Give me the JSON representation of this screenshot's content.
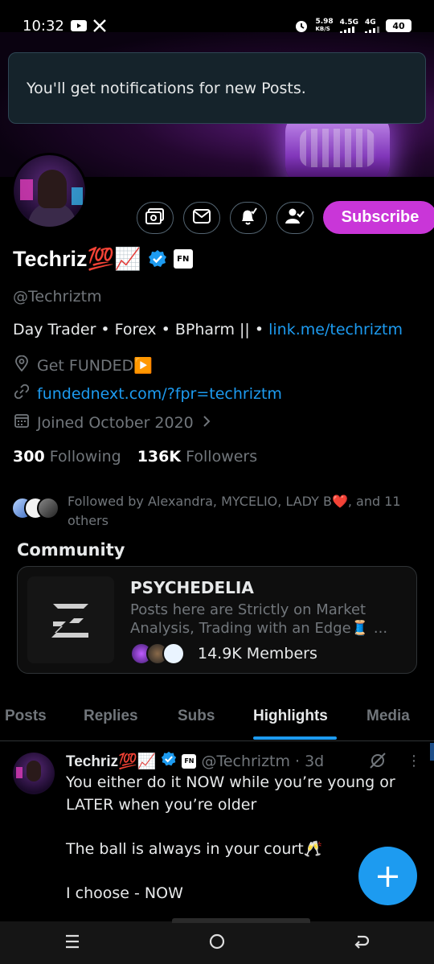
{
  "status_bar": {
    "time": "10:32",
    "speed_value": "5.98",
    "speed_unit": "KB/S",
    "network_1": "4.5G",
    "network_2": "4G",
    "battery": "40"
  },
  "toast": {
    "message": "You'll get notifications for new Posts."
  },
  "profile_actions": {
    "subscribe_label": "Subscribe"
  },
  "profile": {
    "display_name": "Techriz💯📈",
    "fn_badge": "FN",
    "handle": "@Techriztm",
    "bio_text": "Day Trader • Forex • BPharm || • ",
    "bio_link": "link.me/techriztm",
    "location": "Get FUNDED▶️",
    "website": "fundednext.com/?fpr=techriztm",
    "joined": "Joined October 2020",
    "following_count": "300",
    "following_label": "Following",
    "followers_count": "136K",
    "followers_label": "Followers",
    "followed_by": "Followed by Alexandra, MYCELIO, LADY B❤️, and 11 others"
  },
  "community": {
    "section_title": "Community",
    "name": "PSYCHEDELIA",
    "description": "Posts here are Strictly on Market Analysis, Trading with an Edge🧵 ...",
    "members": "14.9K Members"
  },
  "tabs": [
    {
      "label": "Posts"
    },
    {
      "label": "Replies"
    },
    {
      "label": "Subs"
    },
    {
      "label": "Highlights"
    },
    {
      "label": "Media"
    }
  ],
  "active_tab": "Highlights",
  "post": {
    "name": "Techriz💯📈",
    "fn_badge": "FN",
    "handle": "@Techriztm",
    "separator": "·",
    "time": "3d",
    "text": "You either do it NOW while you’re young or LATER when you’re older\n\nThe ball is always in your court🥂\n\nI choose - NOW"
  },
  "fab": {
    "label": "+"
  },
  "colors": {
    "accent": "#1d9bf0",
    "subscribe": "#c936d8",
    "muted": "#71767b",
    "background": "#000000"
  }
}
